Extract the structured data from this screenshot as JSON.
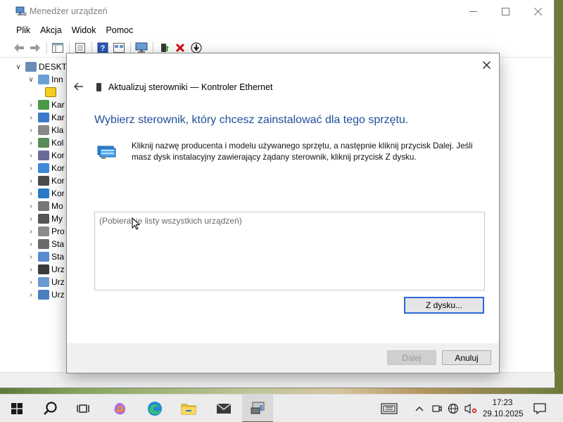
{
  "window": {
    "title": "Menedżer urządzeń",
    "minimize_icon": "minimize-icon",
    "maximize_icon": "maximize-icon",
    "close_icon": "close-icon"
  },
  "menu": [
    "Plik",
    "Akcja",
    "Widok",
    "Pomoc"
  ],
  "toolbar_icons": [
    "back-arrow-icon",
    "forward-arrow-icon",
    "console-tree-icon",
    "properties-icon",
    "help-icon",
    "view-icon",
    "monitor-icon",
    "update-driver-icon",
    "uninstall-icon",
    "scan-download-icon"
  ],
  "tree": {
    "root": "DESKTO",
    "items": [
      "Inn",
      "",
      "Kar",
      "Kar",
      "Kla",
      "Kol",
      "Kor",
      "Kor",
      "Kor",
      "Kor",
      "Mo",
      "My",
      "Pro",
      "Sta",
      "Sta",
      "Urz",
      "Urz",
      "Urz"
    ]
  },
  "dialog": {
    "header_title": "Aktualizuj sterowniki — Kontroler Ethernet",
    "heading": "Wybierz sterownik, który chcesz zainstalować dla tego sprzętu.",
    "instruction": "Kliknij nazwę producenta i modelu używanego sprzętu, a następnie kliknij przycisk Dalej. Jeśli masz dysk instalacyjny zawierający żądany sterownik, kliknij przycisk Z dysku.",
    "list_loading_text": "(Pobieranie listy wszystkich urządzeń)",
    "have_disk_label": "Z dysku...",
    "next_label": "Dalej",
    "cancel_label": "Anuluj",
    "accent_color": "#1f4f9a"
  },
  "taskbar": {
    "time": "17:23",
    "date": "29.10.2025"
  }
}
